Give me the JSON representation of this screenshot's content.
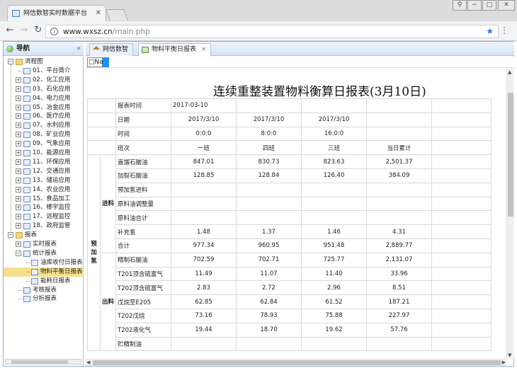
{
  "browser": {
    "tab_title": "网信数智实时数据平台",
    "url_host": "www.wxsz.cn",
    "url_path": "/main.php"
  },
  "sidebar": {
    "title": "导航",
    "collapse_icon": "double-chevron-left-icon",
    "root": "流程图",
    "items": [
      "01、平台简介",
      "02、化工应用",
      "03、石化应用",
      "04、电力应用",
      "05、冶金应用",
      "06、医疗应用",
      "07、水利应用",
      "08、矿业应用",
      "09、气象应用",
      "10、能源应用",
      "11、环保应用",
      "12、交通应用",
      "13、储运应用",
      "14、农业应用",
      "15、食品加工",
      "16、楼宇监控",
      "17、远程监控",
      "18、政府监管"
    ],
    "reports": "报表",
    "realtime": "实时报表",
    "stats": "统计报表",
    "stats_children": [
      "油库收付日报表",
      "物料平衡日报表",
      "能耗日报表"
    ],
    "assess": "考核报表",
    "analysis": "分析报表"
  },
  "tabs": [
    {
      "label": "网信数智",
      "icon": "home-icon"
    },
    {
      "label": "物料平衡日报表",
      "icon": "report-icon",
      "close": "×"
    }
  ],
  "toolbar": {
    "input_value": "□Na!"
  },
  "report": {
    "title": "连续重整装置物料衡算日报表(3月10日)",
    "meta": [
      {
        "label": "报表时间",
        "values": [
          "2017-03-10",
          "",
          "",
          ""
        ]
      },
      {
        "label": "日期",
        "values": [
          "2017/3/10",
          "2017/3/10",
          "2017/3/10",
          ""
        ]
      },
      {
        "label": "时间",
        "values": [
          "0:0:0",
          "8:0:0",
          "16:0:0",
          ""
        ]
      },
      {
        "label": "班次",
        "values": [
          "一班",
          "四班",
          "三班",
          "当日累计"
        ]
      }
    ],
    "group_main": "预加氢",
    "group_in": "进料",
    "group_out": "出料",
    "in_rows": [
      {
        "label": "直馏石脑油",
        "values": [
          "847.01",
          "830.73",
          "823.63",
          "2,501.37"
        ]
      },
      {
        "label": "加裂石脑油",
        "values": [
          "128.85",
          "128.84",
          "126.40",
          "384.09"
        ]
      },
      {
        "label": "预加氢进料",
        "values": [
          "",
          "",
          "",
          ""
        ]
      },
      {
        "label": "原料油调整量",
        "values": [
          "",
          "",
          "",
          ""
        ]
      },
      {
        "label": "原料油合计",
        "values": [
          "",
          "",
          "",
          ""
        ]
      },
      {
        "label": "补充氢",
        "values": [
          "1.48",
          "1.37",
          "1.46",
          "4.31"
        ]
      },
      {
        "label": "合计",
        "values": [
          "977.34",
          "960.95",
          "951.48",
          "2,889.77"
        ]
      }
    ],
    "out_rows": [
      {
        "label": "精制石脑油",
        "values": [
          "702.59",
          "702.71",
          "725.77",
          "2,131.07"
        ]
      },
      {
        "label": "T201顶含硫富气",
        "values": [
          "11.49",
          "11.07",
          "11.40",
          "33.96"
        ]
      },
      {
        "label": "T202顶含硫富气",
        "values": [
          "2.83",
          "2.72",
          "2.96",
          "8.51"
        ]
      },
      {
        "label": "戊烷至E205",
        "values": [
          "62.85",
          "62.84",
          "61.52",
          "187.21"
        ]
      },
      {
        "label": "T202戊烷",
        "values": [
          "73.16",
          "78.93",
          "75.88",
          "227.97"
        ]
      },
      {
        "label": "T202液化气",
        "values": [
          "19.44",
          "18.70",
          "19.62",
          "57.76"
        ]
      },
      {
        "label": "贮精制油",
        "values": [
          "",
          "",
          "",
          ""
        ]
      }
    ]
  }
}
